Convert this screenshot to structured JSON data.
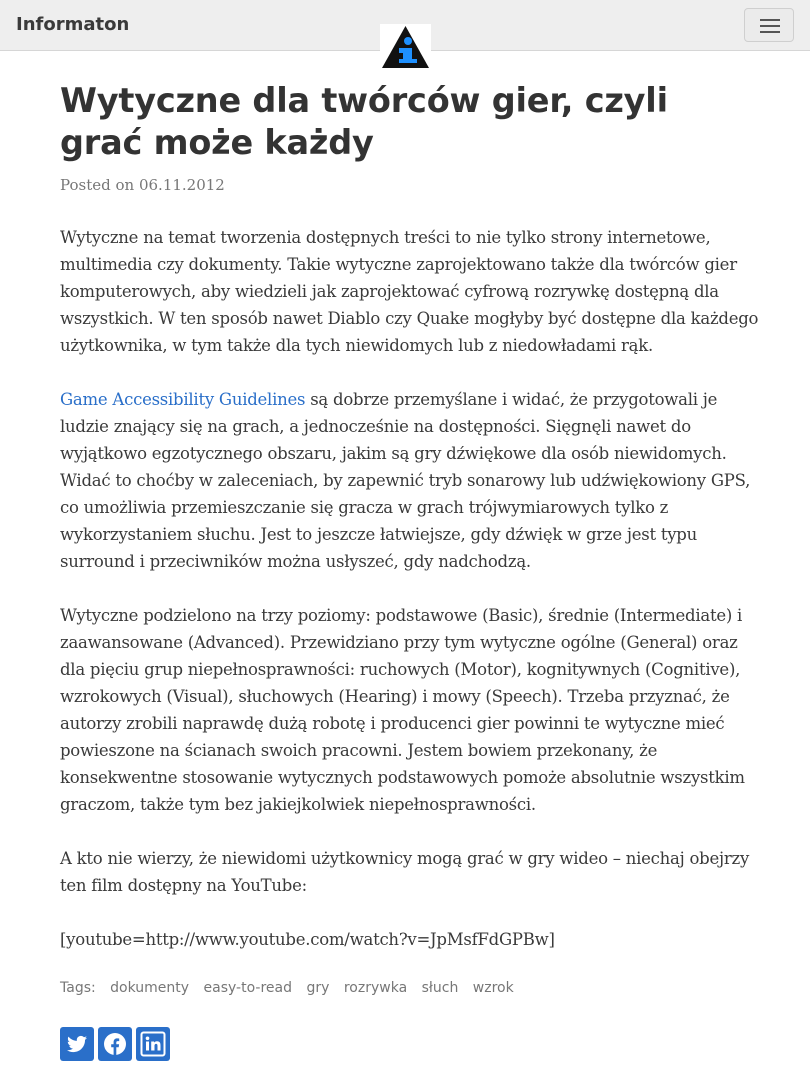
{
  "navbar": {
    "brand": "Informaton"
  },
  "article": {
    "title": "Wytyczne dla twórców gier, czyli grać może każdy",
    "posted_prefix": "Posted on",
    "date": "06.11.2012",
    "paragraphs": {
      "p1": "Wytyczne na temat tworzenia dostępnych treści to nie tylko strony internetowe, multimedia czy dokumenty. Takie wytyczne zaprojektowano także dla twórców gier komputerowych, aby wiedzieli jak zaprojektować cyfrową rozrywkę dostępną dla wszystkich. W ten sposób nawet Diablo czy Quake mogłyby być dostępne dla każdego użytkownika, w tym także dla tych niewidomych lub z niedowładami rąk.",
      "p2_link": "Game Accessibility Guidelines",
      "p2_rest": " są dobrze przemyślane i widać, że przygotowali je ludzie znający się na grach, a jednocześnie na dostępności. Sięgnęli nawet do wyjątkowo egzotycznego obszaru, jakim są gry dźwiękowe dla osób niewidomych. Widać to choćby w zaleceniach, by zapewnić tryb sonarowy lub udźwiękowiony GPS, co umożliwia przemieszczanie się gracza w grach trójwymiarowych tylko z wykorzystaniem słuchu. Jest to jeszcze łatwiejsze, gdy dźwięk w grze jest typu surround i przeciwników można usłyszeć, gdy nadchodzą.",
      "p3": "Wytyczne podzielono na trzy poziomy: podstawowe (Basic), średnie (Intermediate) i zaawansowane (Advanced). Przewidziano przy tym wytyczne ogólne (General) oraz dla pięciu grup niepełnosprawności: ruchowych (Motor), kognitywnych (Cognitive), wzrokowych (Visual), słuchowych (Hearing) i mowy (Speech). Trzeba przyznać, że autorzy zrobili naprawdę dużą robotę i producenci gier powinni te wytyczne mieć powieszone na ścianach swoich pracowni. Jestem bowiem przekonany, że konsekwentne stosowanie wytycznych podstawowych pomoże absolutnie wszystkim graczom, także tym bez jakiejkolwiek niepełnosprawności.",
      "p4": "A kto nie wierzy, że niewidomi użytkownicy mogą grać w gry wideo – niechaj obejrzy ten film dostępny na YouTube:",
      "p5": "[youtube=http://www.youtube.com/watch?v=JpMsfFdGPBw]"
    }
  },
  "tags": {
    "label": "Tags:",
    "items": [
      "dokumenty",
      "easy-to-read",
      "gry",
      "rozrywka",
      "słuch",
      "wzrok"
    ]
  },
  "share": {
    "icons": [
      "twitter-icon",
      "facebook-icon",
      "linkedin-icon"
    ],
    "color": "#2a6fc9"
  },
  "colors": {
    "link": "#2a6fc9",
    "navbar_bg": "#eeeeee",
    "logo_triangle": "#111111",
    "logo_i": "#1e90ff"
  }
}
